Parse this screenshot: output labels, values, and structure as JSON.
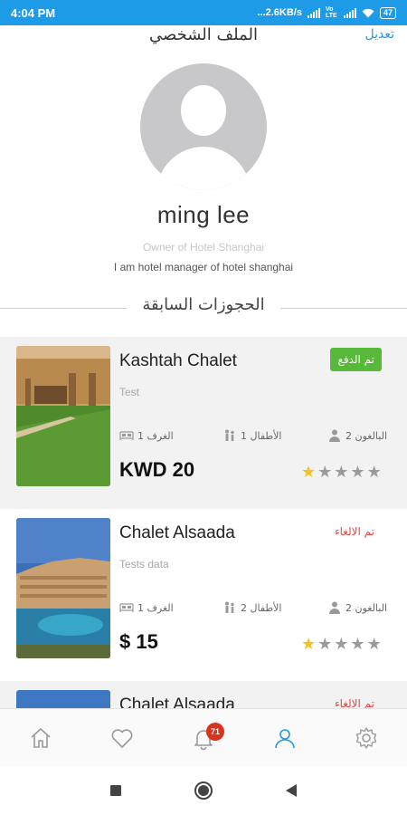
{
  "status_bar": {
    "time": "4:04 PM",
    "network_speed": "...2.6KB/s",
    "volte": "Vo LTE",
    "battery": "47"
  },
  "header": {
    "title": "الملف الشخصي",
    "edit_label": "تعديل"
  },
  "profile": {
    "name": "ming lee",
    "role": "Owner of Hotel Shanghai",
    "bio": "I am hotel manager of hotel shanghai"
  },
  "section": {
    "title": "الحجوزات السابقة"
  },
  "bookings": [
    {
      "name": "Kashtah Chalet",
      "description": "Test",
      "status": "تم الدفع",
      "status_type": "paid",
      "rooms": "1 الغرف",
      "children": "1 الأطفال",
      "adults": "2 البالغون",
      "price": "KWD 20",
      "rating": 1
    },
    {
      "name": "Chalet Alsaada",
      "description": "Tests data",
      "status": "تم الالغاء",
      "status_type": "cancelled",
      "rooms": "1 الغرف",
      "children": "2 الأطفال",
      "adults": "2 البالغون",
      "price": "$ 15",
      "rating": 1
    },
    {
      "name": "Chalet Alsaada",
      "description": "",
      "status": "تم الالغاء",
      "status_type": "cancelled",
      "rooms": "",
      "children": "",
      "adults": "",
      "price": "",
      "rating": 0
    }
  ],
  "bottom_nav": {
    "items": [
      "home-icon",
      "heart-icon",
      "bell-icon",
      "user-icon",
      "gear-icon"
    ],
    "active": "user-icon",
    "notification_count": "71"
  },
  "colors": {
    "accent": "#1e9be6",
    "paid": "#57b83a",
    "cancelled": "#e34646",
    "star": "#f4c21a",
    "badge": "#d8331f"
  }
}
